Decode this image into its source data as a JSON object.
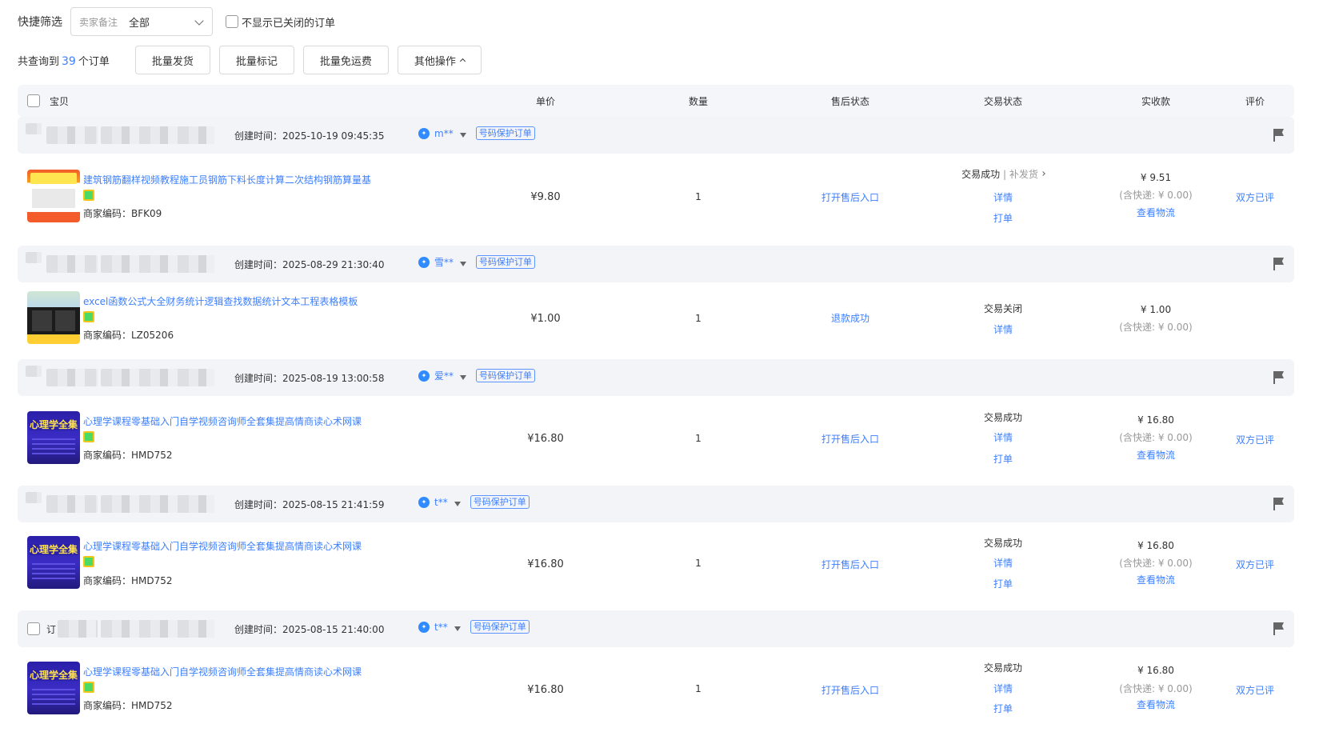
{
  "filter": {
    "label": "快捷筛选",
    "remark_label": "卖家备注",
    "remark_value": "全部",
    "hide_closed_label": "不显示已关闭的订单"
  },
  "actions": {
    "count_prefix": "共查询到",
    "count": "39",
    "count_suffix": "个订单",
    "batch_ship": "批量发货",
    "batch_mark": "批量标记",
    "batch_free_ship": "批量免运费",
    "other_ops": "其他操作"
  },
  "columns": {
    "item": "宝贝",
    "price": "单价",
    "qty": "数量",
    "after_sale": "售后状态",
    "trade": "交易状态",
    "received": "实收款",
    "eval": "评价"
  },
  "orders": [
    {
      "order_prefix": "",
      "created": "创建时间：2025-10-19 09:45:35",
      "buyer": "m**",
      "tag": "号码保护订单",
      "title": "建筑钢筋翻样视频教程施工员钢筋下料长度计算二次结构钢筋算量基",
      "sku": "商家编码：BFK09",
      "price": "¥9.80",
      "qty": "1",
      "after_sale": "打开售后入口",
      "trade_status": "交易成功",
      "trade_extra": "补发货",
      "detail": "详情",
      "print": "打单",
      "received": "¥ 9.51",
      "shipping": "(含快递: ¥ 0.00)",
      "logistics": "查看物流",
      "eval": "双方已评"
    },
    {
      "order_prefix": "",
      "created": "创建时间：2025-08-29 21:30:40",
      "buyer": "雪**",
      "tag": "号码保护订单",
      "title": "excel函数公式大全财务统计逻辑查找数据统计文本工程表格模板",
      "sku": "商家编码：LZ05206",
      "price": "¥1.00",
      "qty": "1",
      "after_sale": "退款成功",
      "trade_status": "交易关闭",
      "detail": "详情",
      "received": "¥ 1.00",
      "shipping": "(含快递: ¥ 0.00)"
    },
    {
      "order_prefix": "",
      "created": "创建时间：2025-08-19 13:00:58",
      "buyer": "爱**",
      "tag": "号码保护订单",
      "title": "心理学课程零基础入门自学视频咨询师全套集提高情商读心术网课",
      "sku": "商家编码：HMD752",
      "price": "¥16.80",
      "qty": "1",
      "after_sale": "打开售后入口",
      "trade_status": "交易成功",
      "detail": "详情",
      "print": "打单",
      "received": "¥ 16.80",
      "shipping": "(含快递: ¥ 0.00)",
      "logistics": "查看物流",
      "eval": "双方已评"
    },
    {
      "order_prefix": "",
      "created": "创建时间：2025-08-15 21:41:59",
      "buyer": "t**",
      "tag": "号码保护订单",
      "title": "心理学课程零基础入门自学视频咨询师全套集提高情商读心术网课",
      "sku": "商家编码：HMD752",
      "price": "¥16.80",
      "qty": "1",
      "after_sale": "打开售后入口",
      "trade_status": "交易成功",
      "detail": "详情",
      "print": "打单",
      "received": "¥ 16.80",
      "shipping": "(含快递: ¥ 0.00)",
      "logistics": "查看物流",
      "eval": "双方已评"
    },
    {
      "order_prefix": "订",
      "created": "创建时间：2025-08-15 21:40:00",
      "buyer": "t**",
      "tag": "号码保护订单",
      "title": "心理学课程零基础入门自学视频咨询师全套集提高情商读心术网课",
      "sku": "商家编码：HMD752",
      "price": "¥16.80",
      "qty": "1",
      "after_sale": "打开售后入口",
      "trade_status": "交易成功",
      "detail": "详情",
      "print": "打单",
      "received": "¥ 16.80",
      "shipping": "(含快递: ¥ 0.00)",
      "logistics": "查看物流",
      "eval": "双方已评"
    }
  ],
  "colors": {
    "link": "#3d7fff",
    "header_bg": "#f5f6fa",
    "order_bg": "#f2f4f8"
  }
}
